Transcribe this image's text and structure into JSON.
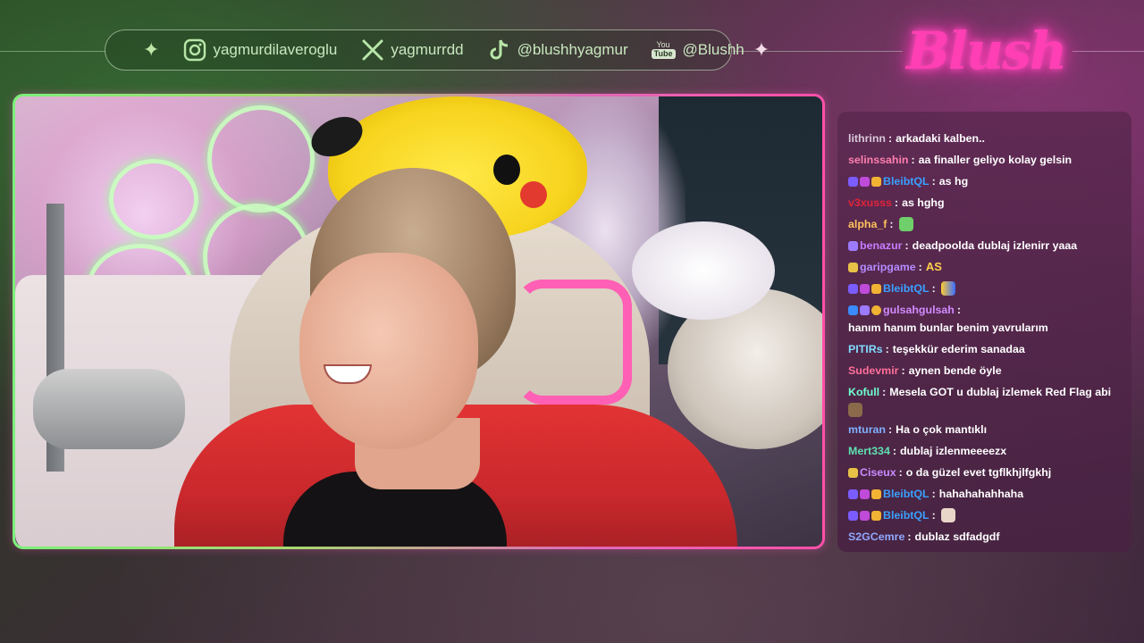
{
  "socials": {
    "instagram": "yagmurdilaveroglu",
    "x": "yagmurrdd",
    "tiktok": "@blushhyagmur",
    "youtube_badge_top": "You",
    "youtube_badge_bottom": "Tube",
    "youtube": "@Blushh"
  },
  "logo": {
    "text": "Blush",
    "color": "#ff3fb3"
  },
  "chat": {
    "messages": [
      {
        "user": "lithrinn",
        "color": "#d8c8d8",
        "text": "arkadaki kalben.."
      },
      {
        "user": "selinssahin",
        "color": "#ff7fb0",
        "text": "aa finaller geliyo kolay gelsin"
      },
      {
        "user": "BleibtQL",
        "color": "#3aa0ff",
        "text": "as hg"
      },
      {
        "user": "v3xusss",
        "color": "#e0243a",
        "text": "as hghg"
      },
      {
        "user": "alpha_f",
        "color": "#ffc15a",
        "text": ""
      },
      {
        "user": "benazur",
        "color": "#c77dff",
        "text": "deadpoolda dublaj izlenirr yaaa"
      },
      {
        "user": "garipgame",
        "color": "#b58bff",
        "text": "AS"
      },
      {
        "user": "BleibtQL",
        "color": "#3aa0ff",
        "text": ""
      },
      {
        "user": "gulsahgulsah",
        "color": "#d28bff",
        "text": "hanım hanım bunlar benim yavrularım"
      },
      {
        "user": "PITIRs",
        "color": "#7fdcff",
        "text": "teşekkür ederim sanadaa"
      },
      {
        "user": "Sudevmir",
        "color": "#ff6f9a",
        "text": "aynen bende öyle"
      },
      {
        "user": "Kofull",
        "color": "#6fffd0",
        "text": "Mesela GOT u dublaj izlemek Red Flag abi"
      },
      {
        "user": "mturan",
        "color": "#7fb0ff",
        "text": "Ha o çok mantıklı"
      },
      {
        "user": "Mert334",
        "color": "#5fe0b0",
        "text": "dublaj izlenmeeeezx"
      },
      {
        "user": "Ciseux",
        "color": "#c98bff",
        "text": "o da güzel evet tgflkhjlfgkhj"
      },
      {
        "user": "BleibtQL",
        "color": "#3aa0ff",
        "text": "hahahahahhaha"
      },
      {
        "user": "BleibtQL",
        "color": "#3aa0ff",
        "text": ""
      },
      {
        "user": "S2GCemre",
        "color": "#8fa8ff",
        "text": "dublaz sdfadgdf"
      }
    ]
  }
}
